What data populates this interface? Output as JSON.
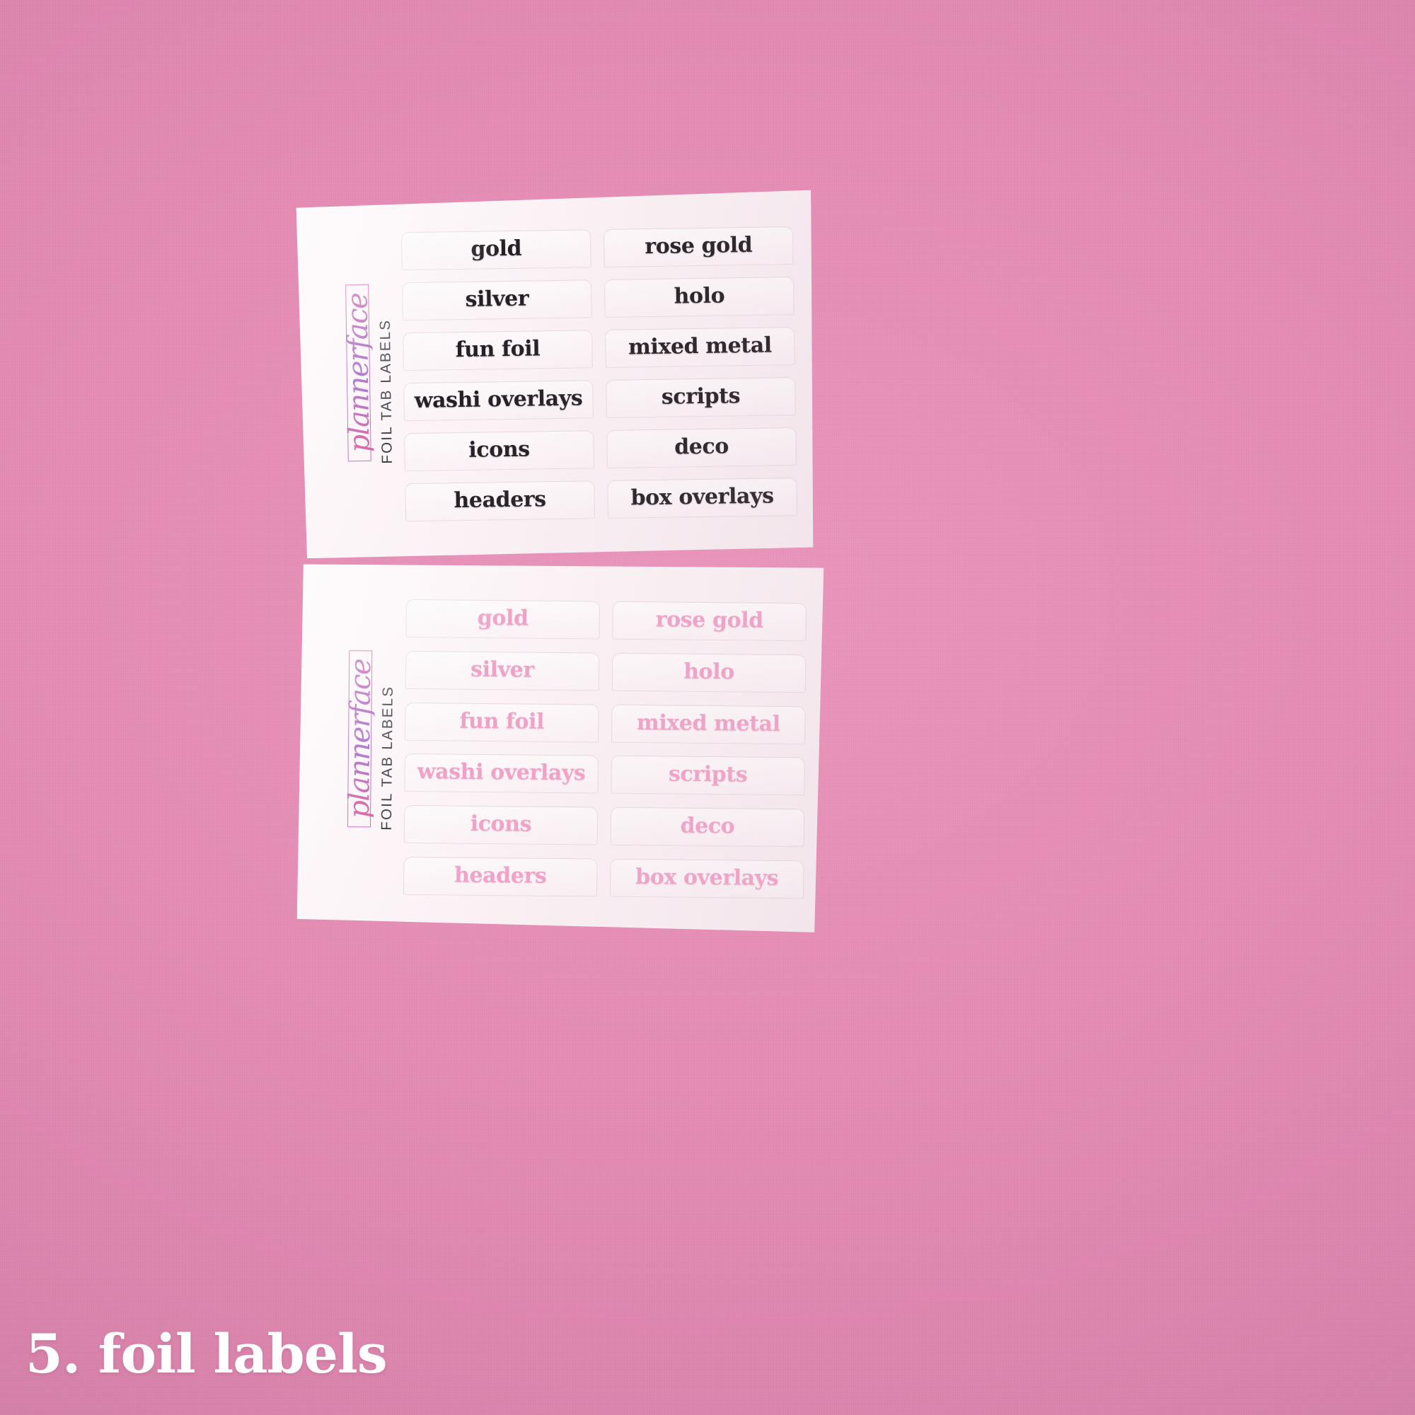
{
  "background": {
    "color": "#e48cb4"
  },
  "caption": {
    "text": "5. foil labels",
    "color": "#ffffff"
  },
  "brand": {
    "wordmark": "plannerface",
    "caption": "FOIL TAB LABELS",
    "wordmark_gradient_start": "#d95b9c",
    "wordmark_gradient_end": "#c564b4",
    "caption_color": "#3a3540"
  },
  "sheets": [
    {
      "id": "sheet-top",
      "variant": "black-foil",
      "text_color": "#231f24",
      "paper_color": "#fbf3f6",
      "tabs": [
        {
          "column": "left",
          "row": 1,
          "label": "gold"
        },
        {
          "column": "right",
          "row": 1,
          "label": "rose gold"
        },
        {
          "column": "left",
          "row": 2,
          "label": "silver"
        },
        {
          "column": "right",
          "row": 2,
          "label": "holo"
        },
        {
          "column": "left",
          "row": 3,
          "label": "fun foil"
        },
        {
          "column": "right",
          "row": 3,
          "label": "mixed metal"
        },
        {
          "column": "left",
          "row": 4,
          "label": "washi overlays"
        },
        {
          "column": "right",
          "row": 4,
          "label": "scripts"
        },
        {
          "column": "left",
          "row": 5,
          "label": "icons"
        },
        {
          "column": "right",
          "row": 5,
          "label": "deco"
        },
        {
          "column": "left",
          "row": 6,
          "label": "headers"
        },
        {
          "column": "right",
          "row": 6,
          "label": "box overlays"
        }
      ]
    },
    {
      "id": "sheet-bottom",
      "variant": "pink-foil",
      "text_color": "#f0a2c6",
      "paper_color": "#fbf3f6",
      "tabs": [
        {
          "column": "left",
          "row": 1,
          "label": "gold"
        },
        {
          "column": "right",
          "row": 1,
          "label": "rose gold"
        },
        {
          "column": "left",
          "row": 2,
          "label": "silver"
        },
        {
          "column": "right",
          "row": 2,
          "label": "holo"
        },
        {
          "column": "left",
          "row": 3,
          "label": "fun foil"
        },
        {
          "column": "right",
          "row": 3,
          "label": "mixed metal"
        },
        {
          "column": "left",
          "row": 4,
          "label": "washi overlays"
        },
        {
          "column": "right",
          "row": 4,
          "label": "scripts"
        },
        {
          "column": "left",
          "row": 5,
          "label": "icons"
        },
        {
          "column": "right",
          "row": 5,
          "label": "deco"
        },
        {
          "column": "left",
          "row": 6,
          "label": "headers"
        },
        {
          "column": "right",
          "row": 6,
          "label": "box overlays"
        }
      ]
    }
  ]
}
